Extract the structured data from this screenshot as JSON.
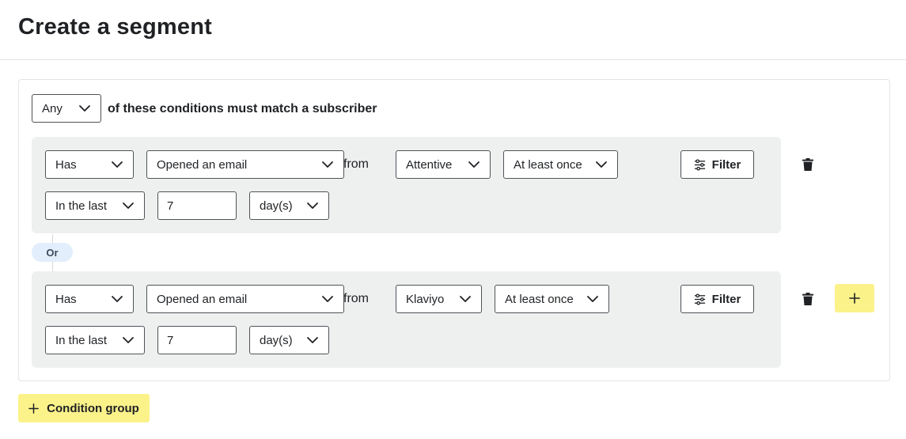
{
  "page": {
    "title": "Create a segment"
  },
  "match": {
    "selector_value": "Any",
    "text": "of these conditions must match a subscriber"
  },
  "connector": {
    "label": "Or"
  },
  "groups": [
    {
      "has_value": "Has",
      "event_value": "Opened an email",
      "from_text": "from",
      "source_value": "Attentive",
      "frequency_value": "At least once",
      "filter_label": "Filter",
      "timeframe_value": "In the last",
      "amount_value": "7",
      "unit_value": "day(s)"
    },
    {
      "has_value": "Has",
      "event_value": "Opened an email",
      "from_text": "from",
      "source_value": "Klaviyo",
      "frequency_value": "At least once",
      "filter_label": "Filter",
      "timeframe_value": "In the last",
      "amount_value": "7",
      "unit_value": "day(s)"
    }
  ],
  "footer": {
    "condition_group_label": "Condition group"
  },
  "colors": {
    "accent_yellow": "#fbf28a",
    "group_bg": "#eef0f0",
    "or_pill_bg": "#e2eefc",
    "border": "#4e5257"
  },
  "icons": {
    "dropdown": "chevron-down-icon",
    "filter": "sliders-icon",
    "delete": "trash-icon",
    "add": "plus-icon"
  }
}
